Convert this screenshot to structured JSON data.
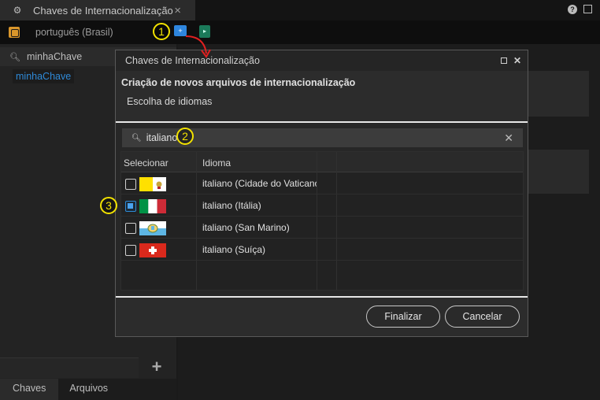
{
  "app": {
    "tab_title": "Chaves de Internacionalização",
    "tab_close": "×",
    "help": "?",
    "language": "português (Brasil)"
  },
  "toolbar": {
    "add_language_icon": "add-language-icon",
    "export_icon": "export-icon"
  },
  "left_panel": {
    "search_value": "minhaChave",
    "key_item": "minhaChave",
    "add_label": "+",
    "tabs": [
      {
        "label": "Chaves"
      },
      {
        "label": "Arquivos"
      }
    ]
  },
  "annotations": {
    "m1": "1",
    "m2": "2",
    "m3": "3",
    "color": "#f2e200"
  },
  "dialog": {
    "title": "Chaves de Internacionalização",
    "subtitle": "Criação de novos arquivos de internacionalização",
    "step": "Escolha de idiomas",
    "search_value": "italiano",
    "clear": "✕",
    "columns": {
      "select": "Selecionar",
      "language": "Idioma"
    },
    "rows": [
      {
        "name": "italiano (Cidade do Vaticano)",
        "checked": false,
        "flag": "vatican"
      },
      {
        "name": "italiano (Itália)",
        "checked": true,
        "flag": "italy"
      },
      {
        "name": "italiano (San Marino)",
        "checked": false,
        "flag": "san-marino"
      },
      {
        "name": "italiano (Suíça)",
        "checked": false,
        "flag": "switzerland"
      }
    ],
    "buttons": {
      "finish": "Finalizar",
      "cancel": "Cancelar"
    }
  },
  "colors": {
    "accent": "#2d8ad6",
    "link": "#2f8ad8",
    "annotation": "#f2e200"
  }
}
